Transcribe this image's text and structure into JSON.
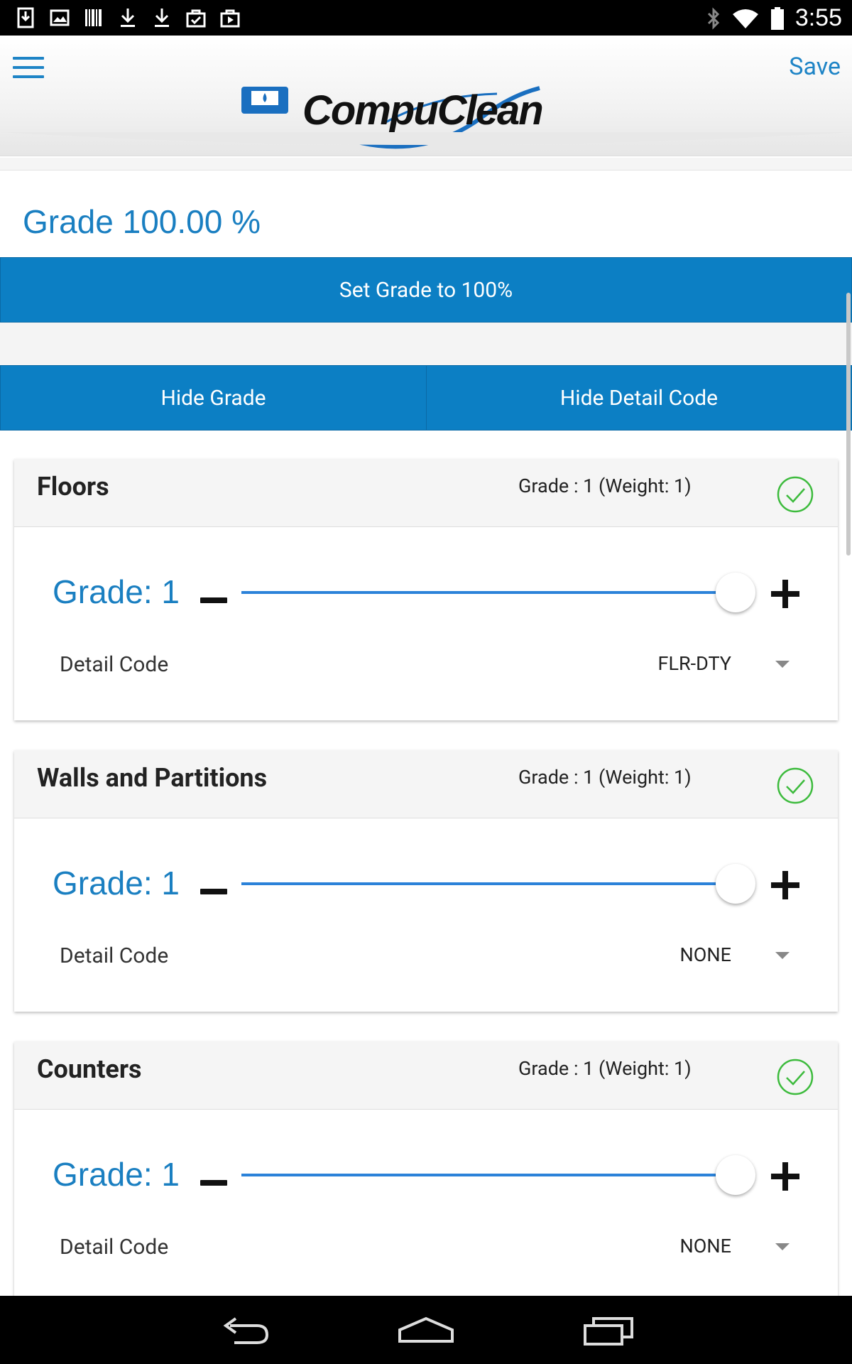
{
  "status_bar": {
    "time": "3:55",
    "left_icons": [
      "download-icon",
      "image-icon",
      "barcode-icon",
      "download-icon",
      "download-icon",
      "shopping-bag-check-icon",
      "shopping-bag-play-icon"
    ],
    "right_icons": [
      "bluetooth-icon",
      "wifi-icon",
      "battery-icon"
    ]
  },
  "header": {
    "brand": "CompuClean",
    "save_label": "Save"
  },
  "grade_summary": "Grade 100.00 %",
  "buttons": {
    "set_grade": "Set Grade to 100%",
    "hide_grade": "Hide Grade",
    "hide_detail_code": "Hide Detail Code"
  },
  "accent_color": "#0c7fc4",
  "sections": [
    {
      "title": "Floors",
      "meta": "Grade : 1 (Weight: 1)",
      "grade_label": "Grade: 1",
      "slider_fraction": 1.0,
      "detail_label": "Detail Code",
      "detail_value": "FLR-DTY"
    },
    {
      "title": "Walls and Partitions",
      "meta": "Grade : 1 (Weight: 1)",
      "grade_label": "Grade: 1",
      "slider_fraction": 1.0,
      "detail_label": "Detail Code",
      "detail_value": "NONE"
    },
    {
      "title": "Counters",
      "meta": "Grade : 1 (Weight: 1)",
      "grade_label": "Grade: 1",
      "slider_fraction": 1.0,
      "detail_label": "Detail Code",
      "detail_value": "NONE"
    }
  ],
  "nav_bar": [
    "back-icon",
    "home-icon",
    "recents-icon"
  ]
}
